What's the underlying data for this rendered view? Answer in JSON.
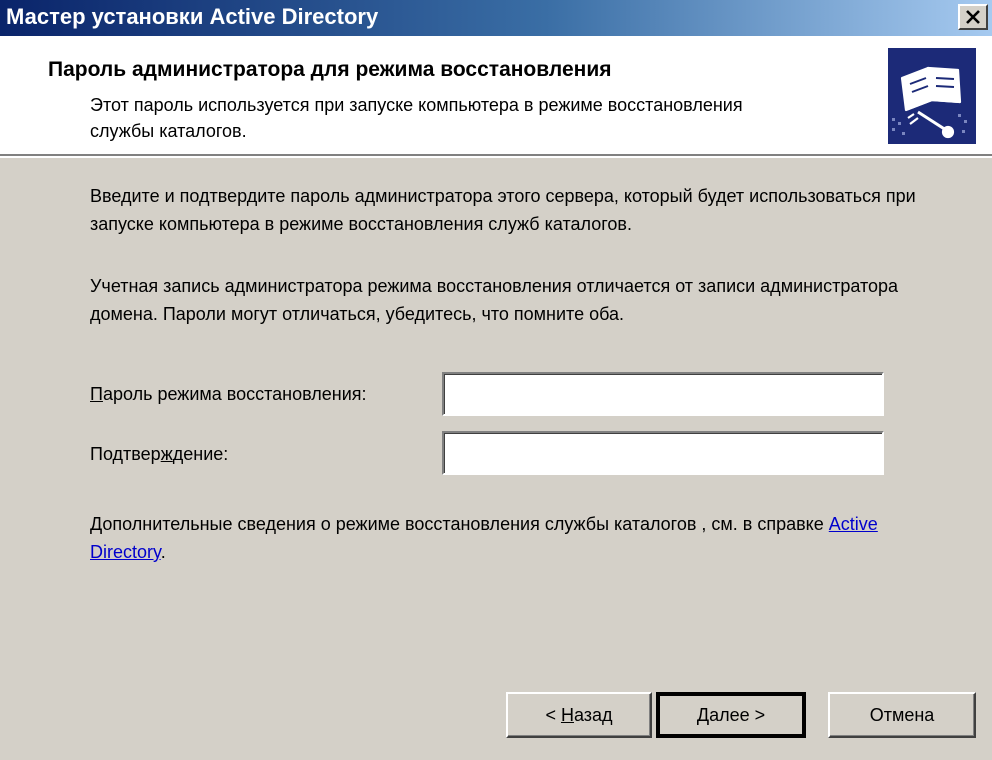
{
  "window": {
    "title": "Мастер установки Active Directory"
  },
  "header": {
    "title": "Пароль администратора для режима восстановления",
    "subtitle": "Этот пароль используется при запуске компьютера в режиме восстановления службы каталогов.",
    "icon": "wizard-book-icon"
  },
  "body": {
    "paragraph1": "Введите и подтвердите пароль администратора этого сервера, который будет использоваться при запуске компьютера в режиме восстановления служб каталогов.",
    "paragraph2": "Учетная запись администратора режима восстановления отличается от записи администратора домена. Пароли могут отличаться, убедитесь, что помните оба.",
    "fields": {
      "password_label_prefix": "",
      "password_label_key": "П",
      "password_label_rest": "ароль режима восстановления:",
      "password_value": "",
      "confirm_label_prefix": "Подтвер",
      "confirm_label_key": "ж",
      "confirm_label_rest": "дение:",
      "confirm_value": ""
    },
    "paragraph3_text": "Дополнительные сведения о режиме восстановления службы каталогов , см. в справке ",
    "paragraph3_link": "Active Directory",
    "paragraph3_end": "."
  },
  "buttons": {
    "back_arrow": "<",
    "back_key": "Н",
    "back_rest": "азад",
    "next_key": "Д",
    "next_rest": "алее",
    "next_arrow": ">",
    "cancel": "Отмена"
  },
  "colors": {
    "titlebar_start": "#0a246a",
    "titlebar_end": "#a6caf0",
    "face": "#d4d0c8",
    "header_icon_bg": "#1c2a78",
    "link": "#0000cc"
  }
}
